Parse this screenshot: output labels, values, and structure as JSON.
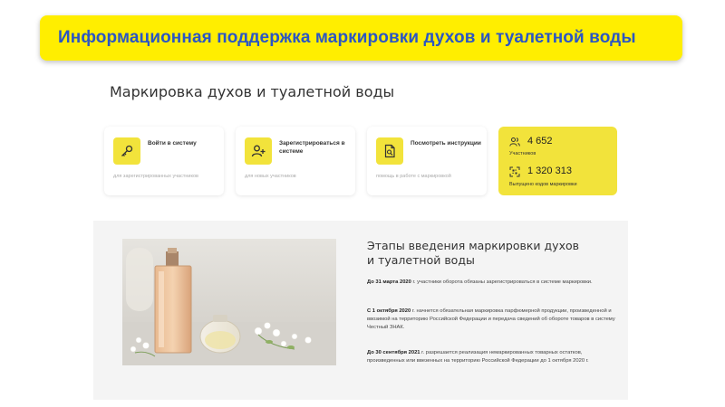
{
  "banner": {
    "title": "Информационная поддержка маркировки духов и туалетной воды"
  },
  "page": {
    "title": "Маркировка духов и туалетной воды"
  },
  "cards": [
    {
      "icon": "key-icon",
      "label": "Войти в систему",
      "sub": "для зарегистрированных участников"
    },
    {
      "icon": "add-user-icon",
      "label": "Зарегистрироваться в системе",
      "sub": "для новых участников"
    },
    {
      "icon": "document-icon",
      "label": "Посмотреть инструкции",
      "sub": "помощь в работе с маркировкой"
    }
  ],
  "stats": {
    "participants": {
      "value": "4 652",
      "caption": "Участников"
    },
    "codes": {
      "value": "1 320 313",
      "caption": "Выпущено кодов маркировки"
    }
  },
  "stages": {
    "title_line1": "Этапы введения маркировки духов",
    "title_line2": "и туалетной воды",
    "items": [
      {
        "date": "До 31 марта 2020",
        "text": " г. участники оборота обязаны зарегистрироваться в системе маркировки."
      },
      {
        "date": "С 1 октября 2020",
        "text": " г. начнется обязательная маркировка парфюмерной продукции, произведенной и ввозимой на территорию Российской Федерации и передача сведений об обороте товаров в систему Честный ЗНАК."
      },
      {
        "date": "До 30 сентября 2021",
        "text": " г. разрешается реализация немаркированных товарных остатков, произведенных или ввезенных на территорию Российской Федерации до 1 октября 2020 г."
      }
    ]
  },
  "colors": {
    "banner_bg": "#ffee00",
    "banner_text": "#2b56c4",
    "accent_yellow": "#f2e33b"
  }
}
